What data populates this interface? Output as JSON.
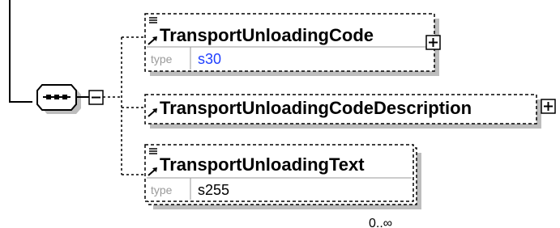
{
  "sequence": {
    "compositor": "sequence",
    "collapse_symbol": "−"
  },
  "elements": [
    {
      "name": "TransportUnloadingCode",
      "type_key": "type",
      "type_value": "s30",
      "type_value_color": "#1f3fff",
      "optional": true,
      "expand_symbol": "+"
    },
    {
      "name": "TransportUnloadingCodeDescription",
      "optional": true,
      "expand_symbol": "+"
    },
    {
      "name": "TransportUnloadingText",
      "type_key": "type",
      "type_value": "s255",
      "type_value_color": "#000000",
      "optional": true,
      "occurrence": "0..∞"
    }
  ],
  "colors": {
    "line": "#000000",
    "shadow": "#bdbdbd",
    "separator": "#9a9a9a"
  }
}
